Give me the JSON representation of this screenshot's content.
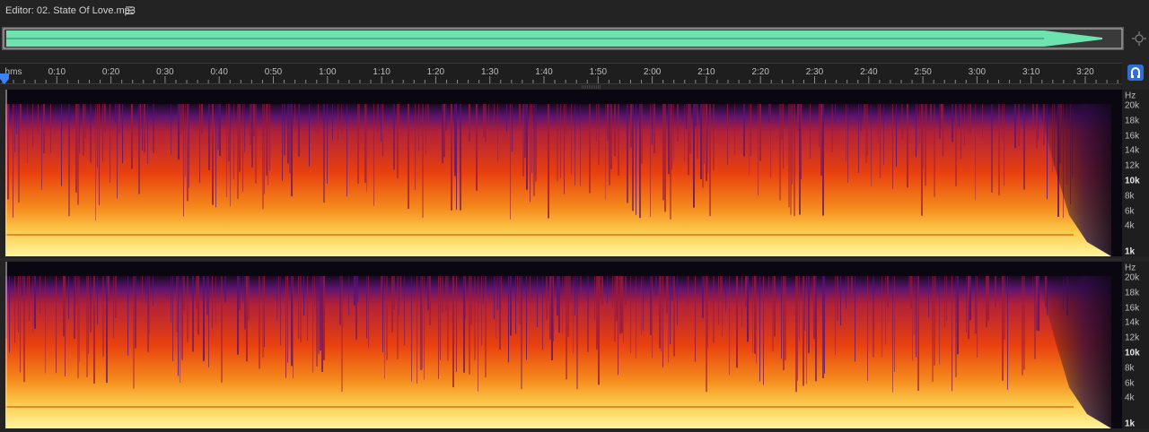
{
  "header": {
    "title": "Editor: 02. State Of Love.mp3",
    "menu_icon": "hamburger-menu-icon"
  },
  "overview": {
    "waveform_color": "#6de3b0",
    "background_color": "#3a3a3a"
  },
  "ruler": {
    "unit_label": "hms",
    "labels": [
      "0:10",
      "0:20",
      "0:30",
      "0:40",
      "0:50",
      "1:00",
      "1:10",
      "1:20",
      "1:30",
      "1:40",
      "1:50",
      "2:00",
      "2:10",
      "2:20",
      "2:30",
      "2:40",
      "2:50",
      "3:00",
      "3:10",
      "3:20"
    ],
    "snap_icon": "magnet-icon"
  },
  "frequency_scale": {
    "unit": "Hz",
    "labels": [
      "20k",
      "18k",
      "16k",
      "14k",
      "12k",
      "10k",
      "8k",
      "6k",
      "4k",
      "1k"
    ],
    "bold_labels": [
      "10k",
      "1k"
    ]
  },
  "colors": {
    "accent": "#2f6fd6",
    "spectrum_low": "#fff07a",
    "spectrum_mid": "#f04a10",
    "spectrum_high": "#5a1470"
  }
}
